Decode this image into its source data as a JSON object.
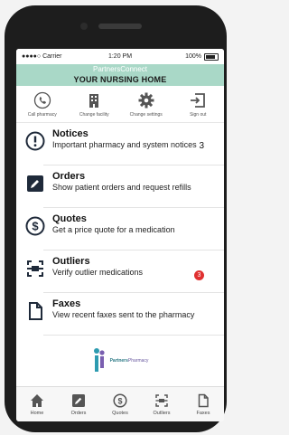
{
  "status": {
    "carrier": "●●●●○ Carrier",
    "time": "1:20 PM",
    "battery": "100%"
  },
  "brand": {
    "line1": "PartnersConnect",
    "line2": "YOUR NURSING HOME"
  },
  "toolbar": [
    {
      "icon": "phone-icon",
      "label": "Call pharmacy"
    },
    {
      "icon": "building-icon",
      "label": "Change facility"
    },
    {
      "icon": "gear-icon",
      "label": "Change settings"
    },
    {
      "icon": "signout-icon",
      "label": "Sign out"
    }
  ],
  "menu": [
    {
      "icon": "exclamation-icon",
      "title": "Notices",
      "desc": "Important pharmacy and system notices",
      "count": "3"
    },
    {
      "icon": "pencil-icon",
      "title": "Orders",
      "desc": "Show patient orders and request refills"
    },
    {
      "icon": "dollar-icon",
      "title": "Quotes",
      "desc": "Get a price quote for a medication"
    },
    {
      "icon": "outlier-icon",
      "title": "Outliers",
      "desc": "Verify outlier medications",
      "badge": "3"
    },
    {
      "icon": "document-icon",
      "title": "Faxes",
      "desc": "View recent faxes sent to the pharmacy"
    }
  ],
  "logo": {
    "name_part1": "Partners",
    "name_part2": "Pharmacy",
    "tagline": "Pharmacy"
  },
  "tabs": [
    {
      "icon": "home-icon",
      "label": "Home"
    },
    {
      "icon": "pencil-icon",
      "label": "Orders"
    },
    {
      "icon": "dollar-icon",
      "label": "Quotes"
    },
    {
      "icon": "outlier-icon",
      "label": "Outliers"
    },
    {
      "icon": "document-icon",
      "label": "Faxes"
    }
  ],
  "colors": {
    "brand_bar": "#a9d8c7",
    "badge": "#e03030",
    "icon_dark": "#1f2a3a",
    "icon_gray": "#555555"
  }
}
